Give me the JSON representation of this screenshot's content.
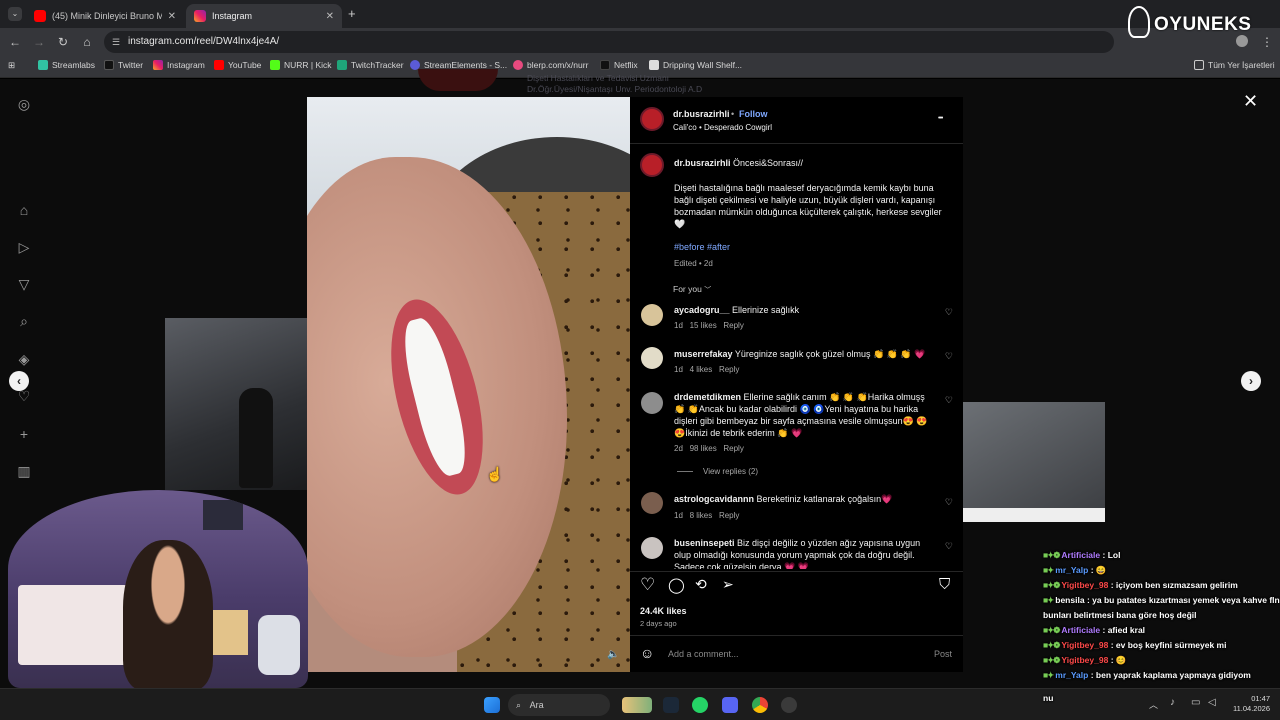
{
  "browser": {
    "tabs": [
      {
        "label": "(45) Minik Dinleyici Bruno Mars",
        "active": false
      },
      {
        "label": "Instagram",
        "active": true
      }
    ],
    "new_tab": "+",
    "url": "instagram.com/reel/DW4lnx4je4A/",
    "bookmarks": [
      "Streamlabs",
      "Twitter",
      "Instagram",
      "YouTube",
      "NURR | Kick",
      "TwitchTracker",
      "StreamElements - S...",
      "blerp.com/x/nurr",
      "Netflix",
      "Dripping Wall Shelf..."
    ],
    "all_bookmarks": "Tüm Yer İşaretleri"
  },
  "logo": {
    "text": "OYUNEKS"
  },
  "background_text": {
    "line1": "Dişeti Hastalıkları ve Tedavisi Uzmanı",
    "line2": "Dr.Öğr.Üyesi/Nişantaşı Unv. Periodontoloji A.D"
  },
  "post": {
    "author": "dr.busrazirhli",
    "follow": "Follow",
    "dot": "•",
    "audio": "Cali'co • Desperado Cowgirl",
    "more": "•••",
    "caption_title": "Öncesi&Sonrası//",
    "caption_body": "Dişeti hastalığına bağlı maalesef deryacığımda kemik kaybı buna bağlı dişeti çekilmesi ve haliyle uzun, büyük dişleri vardı, kapanışı bozmadan mümkün olduğunca küçülterek çalıştık, herkese sevgiler🤍",
    "hashtags": "#before #after",
    "edited": "Edited • 2d",
    "for_you": "For you",
    "comments": [
      {
        "user": "aycadogru__",
        "text": "Ellerinize sağlıkk",
        "age": "1d",
        "likes": "15 likes",
        "reply": "Reply"
      },
      {
        "user": "muserrefakay",
        "text": "Yüreginize saglık çok güzel olmuş 👏 👏 👏 💗",
        "age": "1d",
        "likes": "4 likes",
        "reply": "Reply"
      },
      {
        "user": "drdemetdikmen",
        "text": "Ellerine sağlık canım 👏 👏 👏Harika olmuşş 👏 👏Ancak bu kadar olabilirdi 🧿 🧿Yeni hayatına bu harika dişleri gibi bembeyaz bir sayfa açmasına vesile olmuşsun😍 😍 😍İkinizi de tebrik ederim 👏 💗",
        "age": "2d",
        "likes": "98 likes",
        "reply": "Reply"
      },
      {
        "user": "astrologcavidannn",
        "text": "Bereketiniz katlanarak çoğalsın💗",
        "age": "1d",
        "likes": "8 likes",
        "reply": "Reply"
      },
      {
        "user": "buseninsepeti",
        "text": "Biz dişçi değiliz o yüzden ağız yapısına uygun olup olmadığı konusunda yorum yapmak çok da doğru değil. Sadece çok güzelsin derya 💗 💗",
        "age": "",
        "likes": "",
        "reply": ""
      }
    ],
    "view_replies": "View replies (2)",
    "likes_total": "24.4K likes",
    "posted": "2 days ago",
    "add_comment_placeholder": "Add a comment...",
    "post_button": "Post"
  },
  "chat": [
    {
      "user": "Artificiale",
      "msg": ": Lol",
      "color": "#b07cff"
    },
    {
      "user": "mr_Yalp",
      "msg": ": 😄",
      "color": "#5a9bff"
    },
    {
      "user": "Yigitbey_98",
      "msg": ": içiyom ben sızmazsam gelirim",
      "color": "#ff4a4a"
    },
    {
      "user": "bensila",
      "msg": ": ya bu patates kızartması yemek veya kahve fln bunları belirtmesi bana göre hoş değil",
      "color": "#ffffff"
    },
    {
      "user": "Artificiale",
      "msg": ": afied kral",
      "color": "#b07cff"
    },
    {
      "user": "Yigitbey_98",
      "msg": ": ev boş keyfini sürmeyek mi",
      "color": "#ff4a4a"
    },
    {
      "user": "Yigitbey_98",
      "msg": ": 😊",
      "color": "#ff4a4a"
    },
    {
      "user": "mr_Yalp",
      "msg": ": ben yaprak kaplama yapmaya gidiyom",
      "color": "#5a9bff"
    },
    {
      "user": "",
      "msg": "nu",
      "color": "#ffffff"
    }
  ],
  "taskbar": {
    "search": "Ara",
    "time": "01:47",
    "date": "11.04.2026"
  }
}
